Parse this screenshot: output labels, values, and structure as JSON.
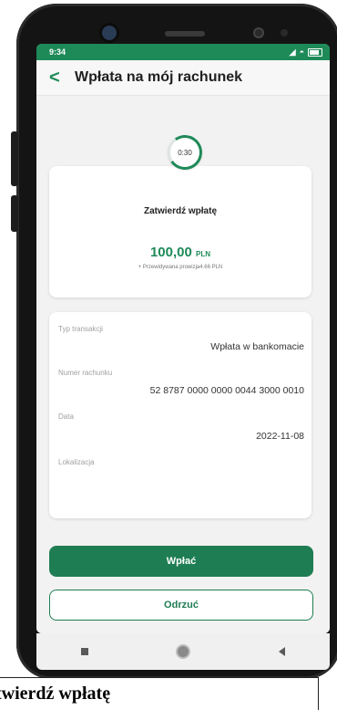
{
  "status_bar": {
    "time": "9:34"
  },
  "header": {
    "back_glyph": "<",
    "title": "Wpłata na mój rachunek"
  },
  "timer": {
    "text": "0:30"
  },
  "confirm_card": {
    "title": "Zatwierdź wpłatę",
    "amount": "100,00",
    "currency": "PLN",
    "fee": "+ Przewidywana prowizja4.66 PLN"
  },
  "details": {
    "type_label": "Typ transakcji",
    "type_value": "Wpłata w bankomacie",
    "account_label": "Numer rachunku",
    "account_value": "52 8787 0000 0000 0044 3000 0010",
    "date_label": "Data",
    "date_value": "2022-11-08",
    "location_label": "Lokalizacja"
  },
  "buttons": {
    "deposit": "Wpłać",
    "reject": "Odrzuć"
  },
  "caption": "twierdź wpłatę",
  "colors": {
    "brand": "#1e8a58",
    "brand_dark": "#1e7d52"
  },
  "icons": [
    "back-arrow-icon",
    "signal-icon",
    "wifi-icon",
    "battery-icon",
    "nav-recents-icon",
    "nav-home-icon",
    "nav-back-icon"
  ]
}
